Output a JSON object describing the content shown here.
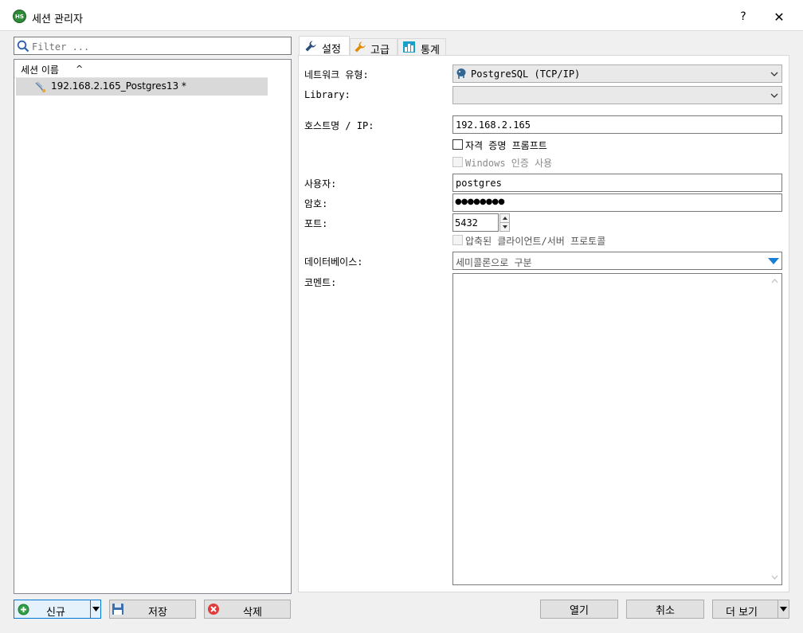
{
  "window": {
    "title": "세션 관리자",
    "app_icon_text": "HS",
    "help_glyph": "?",
    "close_glyph": "✕"
  },
  "left": {
    "filter_placeholder": "Filter ...",
    "column_header": "세션 이름",
    "sort_glyph": "^",
    "sessions": [
      {
        "name": "192.168.2.165_Postgres13 *"
      }
    ]
  },
  "tabs": [
    {
      "label": "설정"
    },
    {
      "label": "고급"
    },
    {
      "label": "통계"
    }
  ],
  "settings": {
    "network_type_label": "네트워크 유형:",
    "network_type_value": "PostgreSQL (TCP/IP)",
    "library_label": "Library:",
    "library_value": "",
    "host_label": "호스트명 / IP:",
    "host_value": "192.168.2.165",
    "prompt_credentials_label": "자격 증명 프롬프트",
    "windows_auth_label": "Windows 인증 사용",
    "user_label": "사용자:",
    "user_value": "postgres",
    "password_label": "암호:",
    "password_value": "●●●●●●●●",
    "port_label": "포트:",
    "port_value": "5432",
    "compressed_label": "압축된 클라이언트/서버 프로토콜",
    "databases_label": "데이터베이스:",
    "databases_placeholder": "세미콜론으로 구분",
    "comment_label": "코멘트:",
    "comment_value": ""
  },
  "buttons": {
    "new": "신규",
    "save": "저장",
    "delete": "삭제",
    "open": "열기",
    "cancel": "취소",
    "more": "더 보기"
  },
  "colors": {
    "accent_blue": "#0078d7",
    "selection": "#d9d9d9",
    "wrench": "#e08a00"
  }
}
